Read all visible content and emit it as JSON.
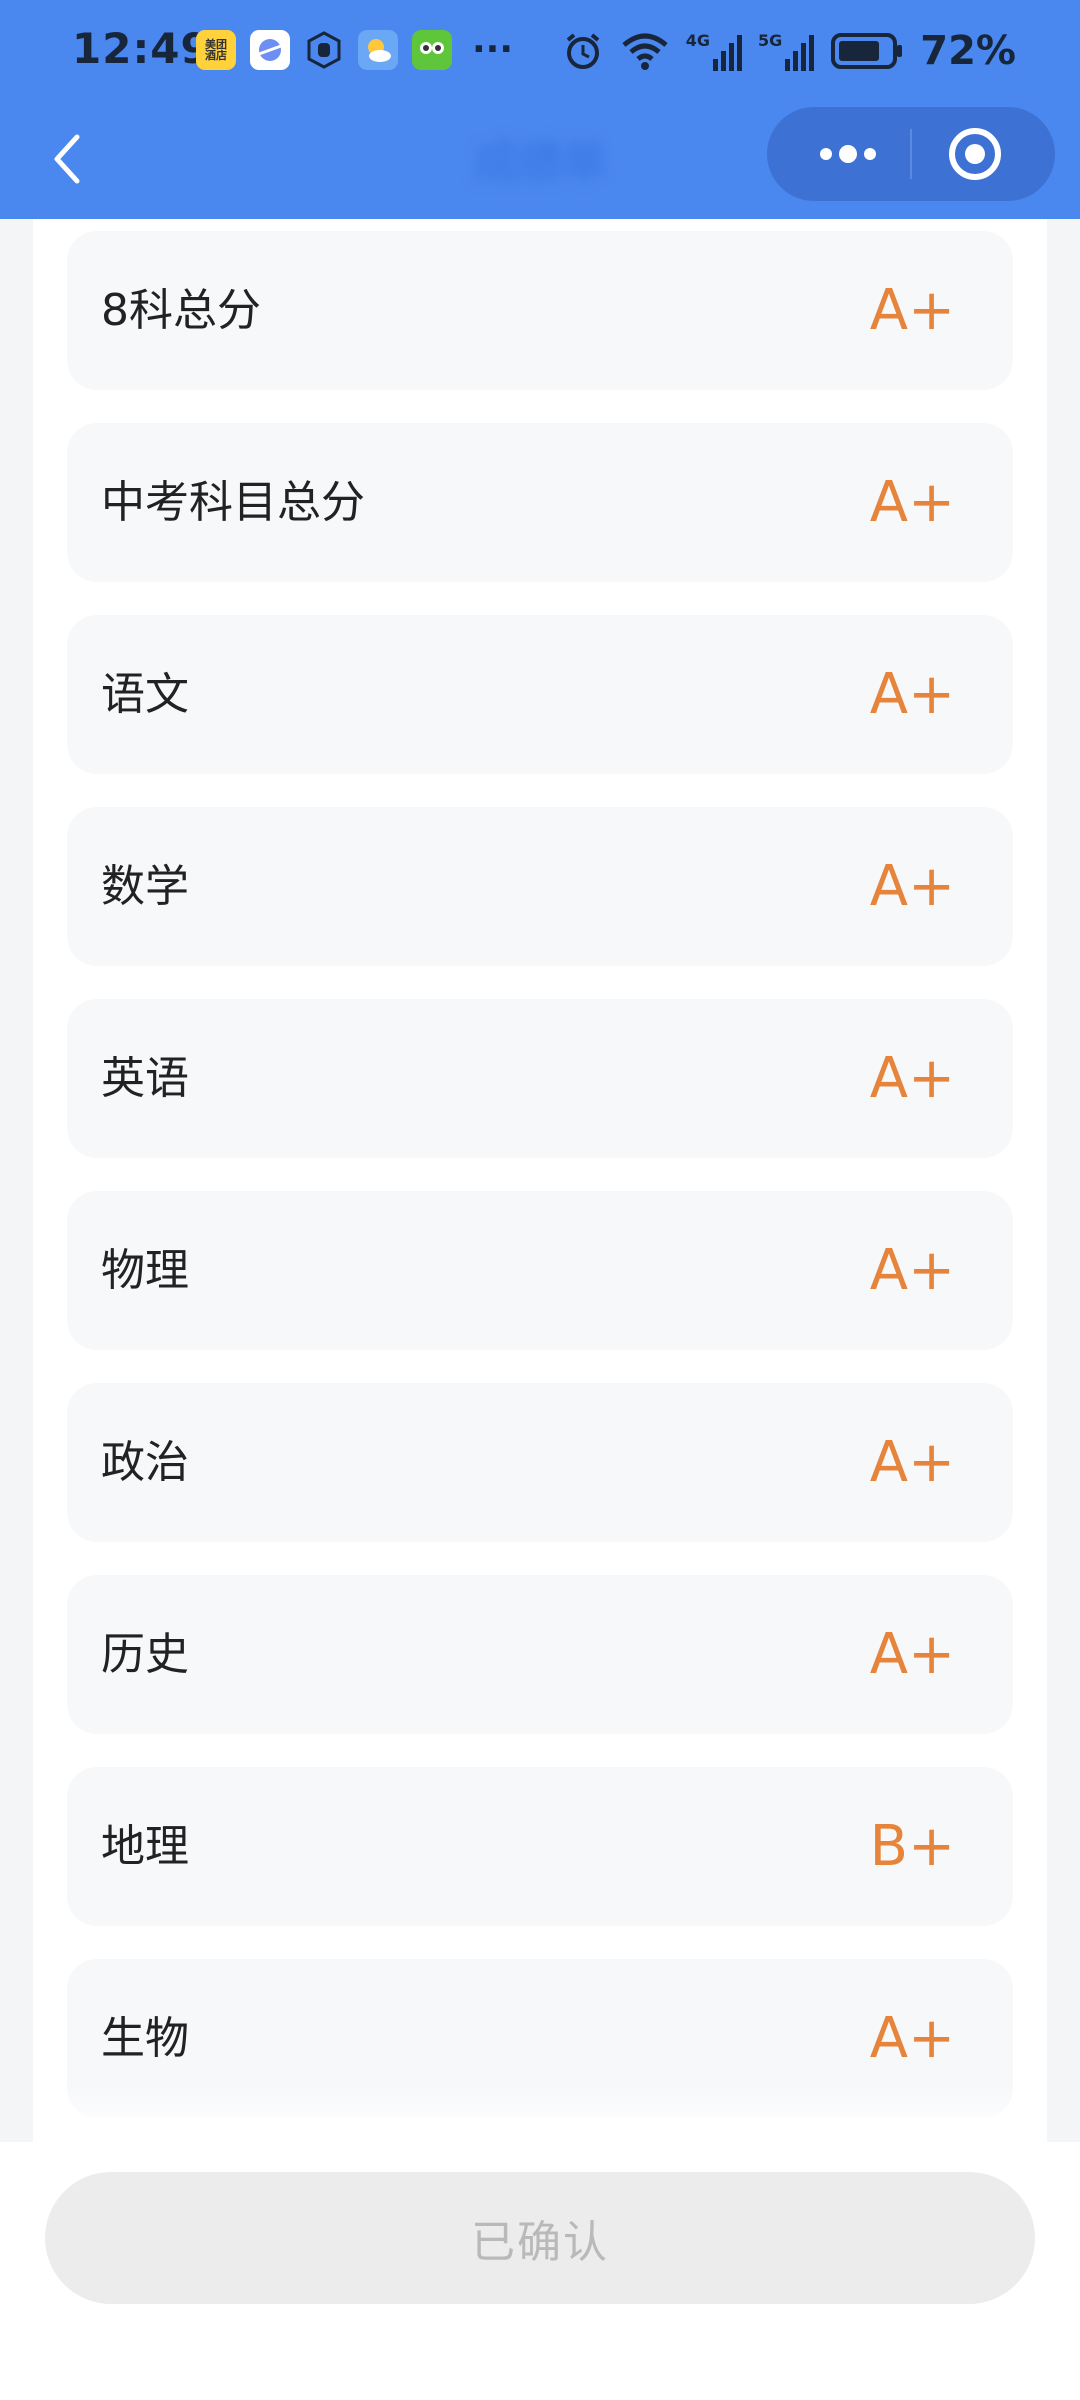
{
  "status_bar": {
    "time": "12:49",
    "notification_icons": [
      "meituan-hotel-icon",
      "planet-app-icon",
      "hand-app-icon",
      "weather-icon",
      "owl-app-icon"
    ],
    "hotel_icon_text": "美团酒店",
    "more_notifications": "···",
    "signal_4g": "4G",
    "signal_5g": "5G",
    "battery_percent": "72%"
  },
  "nav_bar": {
    "title": "成绩单",
    "back_icon": "chevron-left-icon",
    "capsule_more_icon": "more-dots-icon",
    "capsule_close_icon": "target-close-icon",
    "background_color": "#4a87ee"
  },
  "grades": [
    {
      "subject": "8科总分",
      "grade": "A+"
    },
    {
      "subject": "中考科目总分",
      "grade": "A+"
    },
    {
      "subject": "语文",
      "grade": "A+"
    },
    {
      "subject": "数学",
      "grade": "A+"
    },
    {
      "subject": "英语",
      "grade": "A+"
    },
    {
      "subject": "物理",
      "grade": "A+"
    },
    {
      "subject": "政治",
      "grade": "A+"
    },
    {
      "subject": "历史",
      "grade": "A+"
    },
    {
      "subject": "地理",
      "grade": "B+"
    },
    {
      "subject": "生物",
      "grade": "A+"
    }
  ],
  "grade_color": "#e5843a",
  "footer": {
    "confirm_label": "已确认"
  }
}
